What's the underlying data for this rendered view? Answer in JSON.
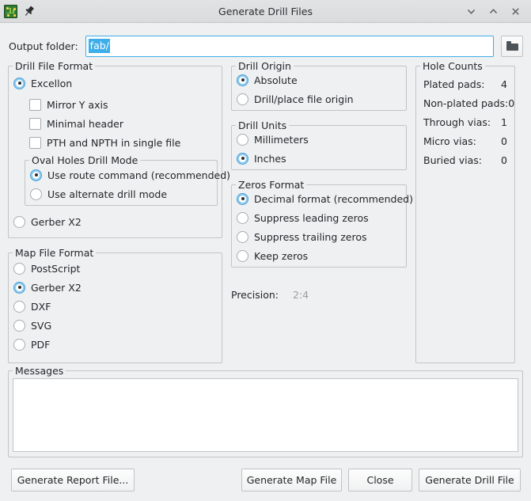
{
  "window": {
    "title": "Generate Drill Files",
    "app_icon": "pcb-board-icon",
    "pin_icon": "pin-icon",
    "controls": [
      {
        "name": "minimize-button",
        "glyph": "chevron-down-icon"
      },
      {
        "name": "maximize-button",
        "glyph": "chevron-up-icon"
      },
      {
        "name": "close-button",
        "glyph": "close-icon"
      }
    ]
  },
  "output_folder": {
    "label": "Output folder:",
    "value": "fab/",
    "placeholder": "",
    "browse_icon": "folder-icon",
    "selected": true
  },
  "drill_file_format": {
    "title": "Drill File Format",
    "options": [
      {
        "label": "Excellon",
        "selected": true
      },
      {
        "label": "Gerber X2",
        "selected": false
      }
    ],
    "checkboxes": [
      {
        "label": "Mirror Y axis",
        "checked": false
      },
      {
        "label": "Minimal header",
        "checked": false
      },
      {
        "label": "PTH and NPTH in single file",
        "checked": false
      }
    ],
    "oval_holes": {
      "title": "Oval Holes Drill Mode",
      "options": [
        {
          "label": "Use route command (recommended)",
          "selected": true
        },
        {
          "label": "Use alternate drill mode",
          "selected": false
        }
      ]
    }
  },
  "map_file_format": {
    "title": "Map File Format",
    "options": [
      {
        "label": "PostScript",
        "selected": false
      },
      {
        "label": "Gerber X2",
        "selected": true
      },
      {
        "label": "DXF",
        "selected": false
      },
      {
        "label": "SVG",
        "selected": false
      },
      {
        "label": "PDF",
        "selected": false
      }
    ]
  },
  "drill_origin": {
    "title": "Drill Origin",
    "options": [
      {
        "label": "Absolute",
        "selected": true
      },
      {
        "label": "Drill/place file origin",
        "selected": false
      }
    ]
  },
  "drill_units": {
    "title": "Drill Units",
    "options": [
      {
        "label": "Millimeters",
        "selected": false
      },
      {
        "label": "Inches",
        "selected": true
      }
    ]
  },
  "zeros_format": {
    "title": "Zeros Format",
    "options": [
      {
        "label": "Decimal format (recommended)",
        "selected": true
      },
      {
        "label": "Suppress leading zeros",
        "selected": false
      },
      {
        "label": "Suppress trailing zeros",
        "selected": false
      },
      {
        "label": "Keep zeros",
        "selected": false
      }
    ]
  },
  "precision": {
    "label": "Precision:",
    "value": "2:4"
  },
  "hole_counts": {
    "title": "Hole Counts",
    "rows": [
      {
        "name": "Plated pads:",
        "value": "4"
      },
      {
        "name": "Non-plated pads:",
        "value": "0"
      },
      {
        "name": "Through vias:",
        "value": "1"
      },
      {
        "name": "Micro vias:",
        "value": "0"
      },
      {
        "name": "Buried vias:",
        "value": "0"
      }
    ]
  },
  "messages": {
    "title": "Messages",
    "content": ""
  },
  "buttons": {
    "generate_report": "Generate Report File...",
    "generate_map": "Generate Map File",
    "close": "Close",
    "generate_drill": "Generate Drill File"
  },
  "colors": {
    "accent": "#3daee9",
    "window_bg": "#eff0f1",
    "titlebar_bg": "#dcdddd",
    "text": "#232629",
    "disabled_text": "#9a9ea1"
  }
}
